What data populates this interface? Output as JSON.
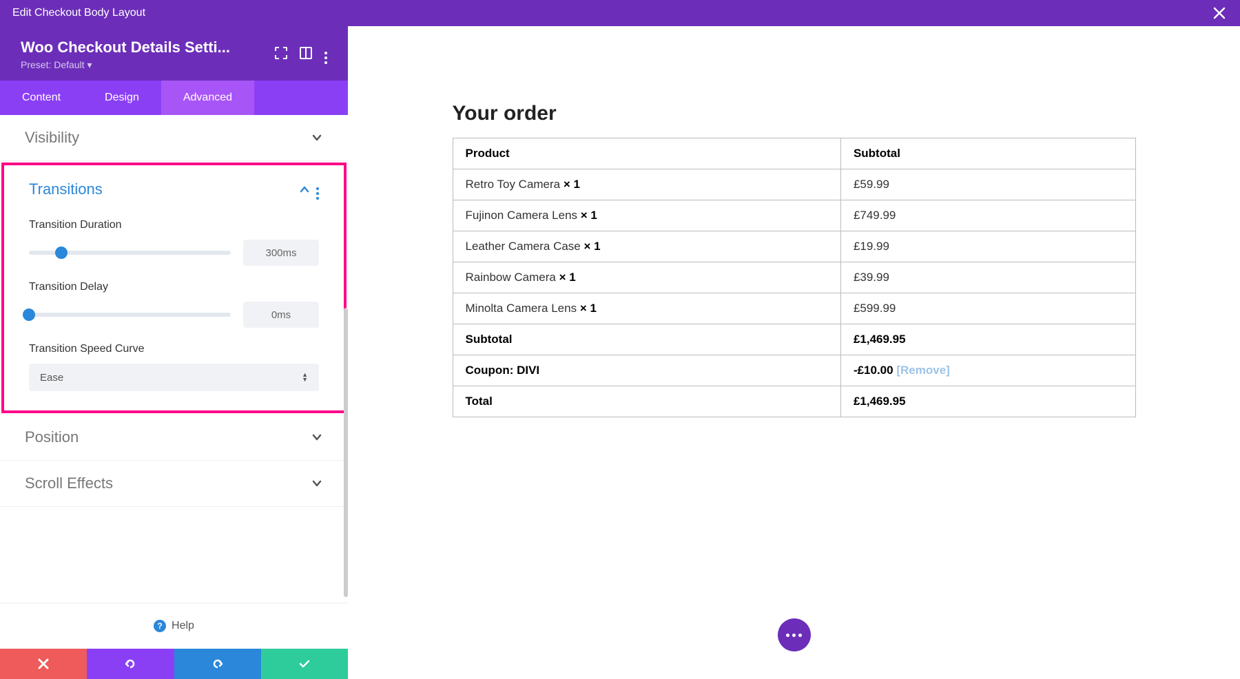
{
  "topbar": {
    "title": "Edit Checkout Body Layout"
  },
  "sidebar": {
    "title": "Woo Checkout Details Setti...",
    "preset_label": "Preset: Default ▾",
    "tabs": {
      "content": "Content",
      "design": "Design",
      "advanced": "Advanced"
    },
    "sections": {
      "visibility": "Visibility",
      "transitions": "Transitions",
      "position": "Position",
      "scroll_effects": "Scroll Effects"
    },
    "transitions": {
      "duration_label": "Transition Duration",
      "duration_value": "300ms",
      "delay_label": "Transition Delay",
      "delay_value": "0ms",
      "curve_label": "Transition Speed Curve",
      "curve_value": "Ease"
    },
    "help": "Help"
  },
  "order": {
    "title": "Your order",
    "headers": {
      "product": "Product",
      "subtotal": "Subtotal"
    },
    "items": [
      {
        "name": "Retro Toy Camera",
        "qty": "× 1",
        "price": "£59.99"
      },
      {
        "name": "Fujinon Camera Lens",
        "qty": "× 1",
        "price": "£749.99"
      },
      {
        "name": "Leather Camera Case",
        "qty": "× 1",
        "price": "£19.99"
      },
      {
        "name": "Rainbow Camera",
        "qty": "× 1",
        "price": "£39.99"
      },
      {
        "name": "Minolta Camera Lens",
        "qty": "× 1",
        "price": "£599.99"
      }
    ],
    "subtotal_label": "Subtotal",
    "subtotal_value": "£1,469.95",
    "coupon_label": "Coupon: DIVI",
    "coupon_value": "-£10.00",
    "coupon_remove": "[Remove]",
    "total_label": "Total",
    "total_value": "£1,469.95"
  }
}
